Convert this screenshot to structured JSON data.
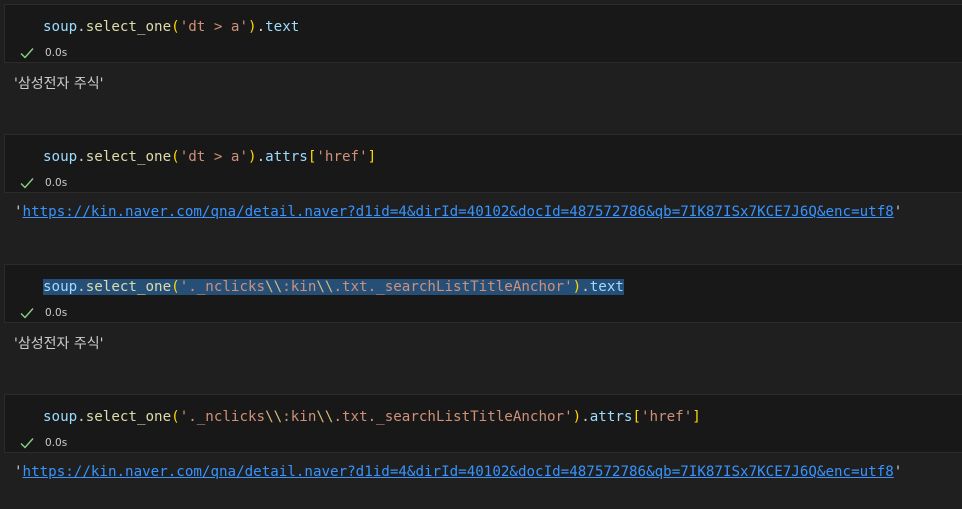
{
  "cells": [
    {
      "code": {
        "var": "soup",
        "dot1": ".",
        "fn": "select_one",
        "open": "(",
        "str": "'dt > a'",
        "close": ")",
        "dot2": ".",
        "attr": "text"
      },
      "time": "0.0s",
      "output": "'삼성전자 주식'"
    },
    {
      "code": {
        "var": "soup",
        "dot1": ".",
        "fn": "select_one",
        "open": "(",
        "str": "'dt > a'",
        "close": ")",
        "dot2": ".",
        "attr": "attrs",
        "bopen": "[",
        "key": "'href'",
        "bclose": "]"
      },
      "time": "0.0s",
      "output": {
        "quote_open": "'",
        "url": "https://kin.naver.com/qna/detail.naver?d1id=4&dirId=40102&docId=487572786&qb=7IK87ISx7KCE7J6Q&enc=utf8",
        "quote_close": "'"
      }
    },
    {
      "code": {
        "var": "soup",
        "dot1": ".",
        "fn": "select_one",
        "open": "(",
        "str_a": "'._nclicks",
        "esc1": "\\\\",
        "str_b": ":kin",
        "esc2": "\\\\",
        "str_c": ".txt._searchListTitleAnchor'",
        "close": ")",
        "dot2": ".",
        "attr": "text"
      },
      "time": "0.0s",
      "output": "'삼성전자 주식'"
    },
    {
      "code": {
        "var": "soup",
        "dot1": ".",
        "fn": "select_one",
        "open": "(",
        "str_a": "'._nclicks",
        "esc1": "\\\\",
        "str_b": ":kin",
        "esc2": "\\\\",
        "str_c": ".txt._searchListTitleAnchor'",
        "close": ")",
        "dot2": ".",
        "attr": "attrs",
        "bopen": "[",
        "key": "'href'",
        "bclose": "]"
      },
      "time": "0.0s",
      "output": {
        "quote_open": "'",
        "url": "https://kin.naver.com/qna/detail.naver?d1id=4&dirId=40102&docId=487572786&qb=7IK87ISx7KCE7J6Q&enc=utf8",
        "quote_close": "'"
      }
    }
  ],
  "colors": {
    "background": "#1f1f1f",
    "cell_background": "#181818",
    "check": "#89d185",
    "link": "#3794ff",
    "string": "#ce9178",
    "function": "#dcdcaa",
    "variable": "#9cdcfe",
    "bracket_1": "#ffd700",
    "bracket_2": "#da70d6",
    "escape": "#d7ba7d",
    "selection": "#264f78"
  },
  "icons": {
    "status": "check-icon"
  }
}
